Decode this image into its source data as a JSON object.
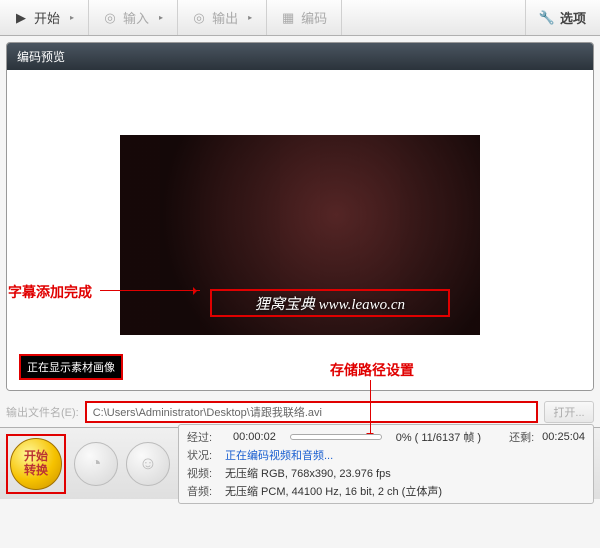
{
  "toolbar": {
    "start": "开始",
    "input": "输入",
    "output": "输出",
    "encode": "编码",
    "options": "选项"
  },
  "preview": {
    "title": "编码预览",
    "subtitle_text": "狸窝宝典  www.leawo.cn",
    "status_text": "正在显示素材画像"
  },
  "annotations": {
    "subtitle_done": "字幕添加完成",
    "storage_path": "存储路径设置"
  },
  "output": {
    "label": "输出文件名(E):",
    "path": "C:\\Users\\Administrator\\Desktop\\请跟我联络.avi",
    "open": "打开..."
  },
  "bottom": {
    "start_convert_l1": "开始",
    "start_convert_l2": "转换",
    "elapsed_label": "经过:",
    "elapsed_value": "00:00:02",
    "progress_text": "0% ( 11/6137 帧 )",
    "remain_label": "还剩:",
    "remain_value": "00:25:04",
    "status_label": "状况:",
    "status_value": "正在编码视频和音频...",
    "video_label": "视频:",
    "video_value": "无压缩 RGB, 768x390, 23.976 fps",
    "audio_label": "音频:",
    "audio_value": "无压缩 PCM, 44100 Hz, 16 bit, 2 ch (立体声)"
  }
}
